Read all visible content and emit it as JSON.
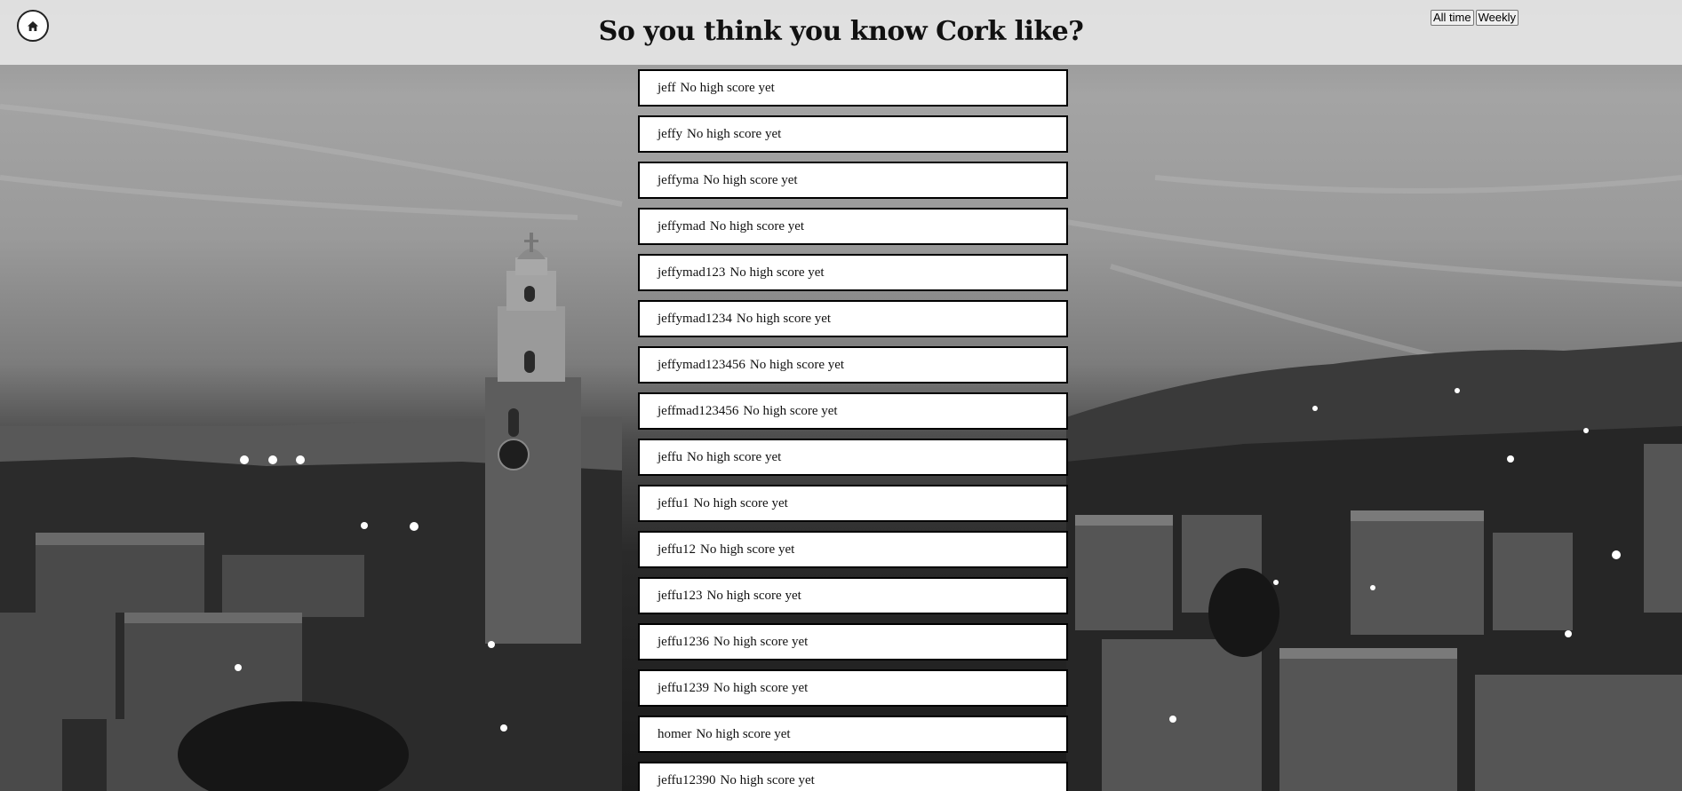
{
  "header": {
    "title": "So you think you know Cork like?",
    "home_icon": "home-icon",
    "range_buttons": [
      "All time",
      "Weekly"
    ]
  },
  "leaderboard": [
    {
      "name": "jeff",
      "score": "No high score yet"
    },
    {
      "name": "jeffy",
      "score": "No high score yet"
    },
    {
      "name": "jeffyma",
      "score": "No high score yet"
    },
    {
      "name": "jeffymad",
      "score": "No high score yet"
    },
    {
      "name": "jeffymad123",
      "score": "No high score yet"
    },
    {
      "name": "jeffymad1234",
      "score": "No high score yet"
    },
    {
      "name": "jeffymad123456",
      "score": "No high score yet"
    },
    {
      "name": "jeffmad123456",
      "score": "No high score yet"
    },
    {
      "name": "jeffu",
      "score": "No high score yet"
    },
    {
      "name": "jeffu1",
      "score": "No high score yet"
    },
    {
      "name": "jeffu12",
      "score": "No high score yet"
    },
    {
      "name": "jeffu123",
      "score": "No high score yet"
    },
    {
      "name": "jeffu1236",
      "score": "No high score yet"
    },
    {
      "name": "jeffu1239",
      "score": "No high score yet"
    },
    {
      "name": "homer",
      "score": "No high score yet"
    },
    {
      "name": "jeffu12390",
      "score": "No high score yet"
    }
  ]
}
